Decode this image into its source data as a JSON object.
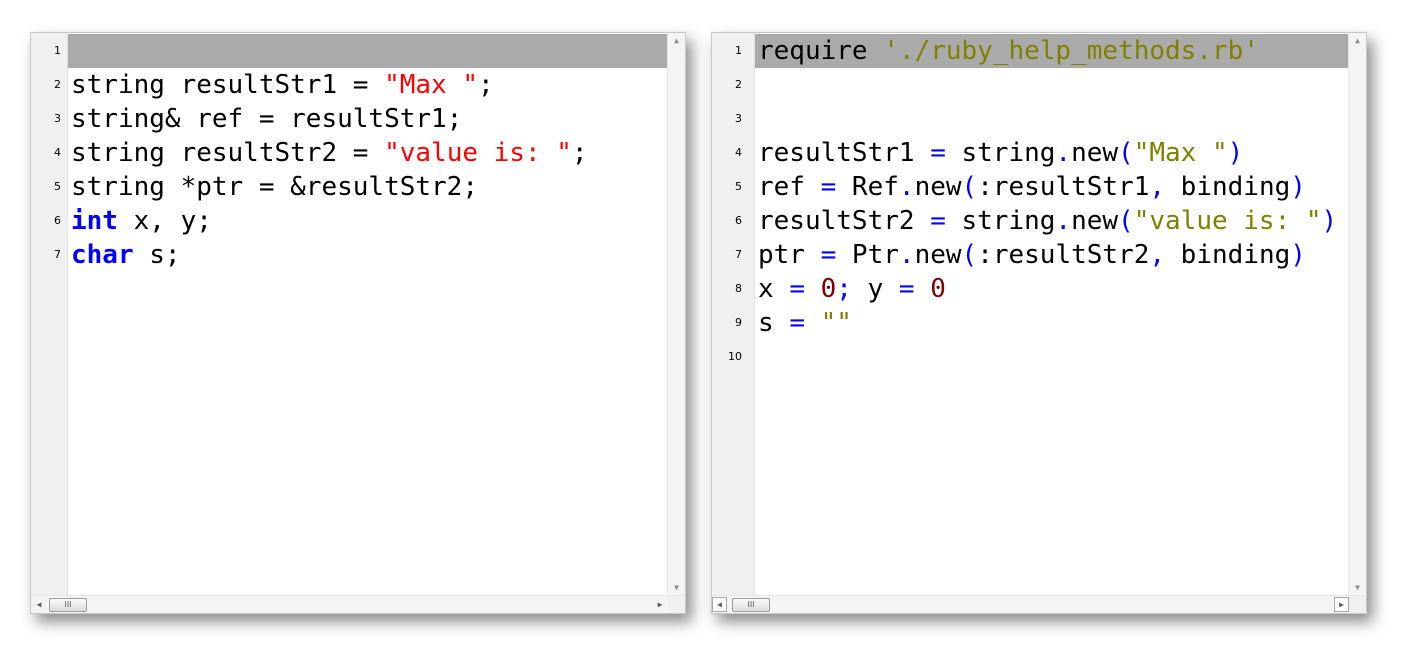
{
  "left_editor": {
    "lines": [
      {
        "num": "1",
        "tokens": []
      },
      {
        "num": "2",
        "tokens": [
          {
            "t": "string resultStr1 = ",
            "c": ""
          },
          {
            "t": "\"Max \"",
            "c": "str"
          },
          {
            "t": ";",
            "c": ""
          }
        ]
      },
      {
        "num": "3",
        "tokens": [
          {
            "t": "string& ref = resultStr1;",
            "c": ""
          }
        ]
      },
      {
        "num": "4",
        "tokens": [
          {
            "t": "string resultStr2 = ",
            "c": ""
          },
          {
            "t": "\"value is: \"",
            "c": "str"
          },
          {
            "t": ";",
            "c": ""
          }
        ]
      },
      {
        "num": "5",
        "tokens": [
          {
            "t": "string *ptr = &resultStr2;",
            "c": ""
          }
        ]
      },
      {
        "num": "6",
        "tokens": [
          {
            "t": "int",
            "c": "kw"
          },
          {
            "t": " x, y;",
            "c": ""
          }
        ]
      },
      {
        "num": "7",
        "tokens": [
          {
            "t": "char",
            "c": "kw"
          },
          {
            "t": " s;",
            "c": ""
          }
        ]
      }
    ]
  },
  "right_editor": {
    "lines": [
      {
        "num": "1",
        "tokens": [
          {
            "t": "require ",
            "c": ""
          },
          {
            "t": "'./ruby_help_methods.rb'",
            "c": "rstr"
          }
        ]
      },
      {
        "num": "2",
        "tokens": []
      },
      {
        "num": "3",
        "tokens": []
      },
      {
        "num": "4",
        "tokens": [
          {
            "t": "resultStr1 ",
            "c": ""
          },
          {
            "t": "=",
            "c": "op"
          },
          {
            "t": " string",
            "c": ""
          },
          {
            "t": ".",
            "c": "op"
          },
          {
            "t": "new",
            "c": ""
          },
          {
            "t": "(",
            "c": "op"
          },
          {
            "t": "\"Max \"",
            "c": "rstr"
          },
          {
            "t": ")",
            "c": "op"
          }
        ]
      },
      {
        "num": "5",
        "tokens": [
          {
            "t": "ref ",
            "c": ""
          },
          {
            "t": "=",
            "c": "op"
          },
          {
            "t": " Ref",
            "c": ""
          },
          {
            "t": ".",
            "c": "op"
          },
          {
            "t": "new",
            "c": ""
          },
          {
            "t": "(",
            "c": "op"
          },
          {
            "t": ":resultStr1",
            "c": ""
          },
          {
            "t": ",",
            "c": "op"
          },
          {
            "t": " binding",
            "c": ""
          },
          {
            "t": ")",
            "c": "op"
          }
        ]
      },
      {
        "num": "6",
        "tokens": [
          {
            "t": "resultStr2 ",
            "c": ""
          },
          {
            "t": "=",
            "c": "op"
          },
          {
            "t": " string",
            "c": ""
          },
          {
            "t": ".",
            "c": "op"
          },
          {
            "t": "new",
            "c": ""
          },
          {
            "t": "(",
            "c": "op"
          },
          {
            "t": "\"value is: \"",
            "c": "rstr"
          },
          {
            "t": ")",
            "c": "op"
          }
        ]
      },
      {
        "num": "7",
        "tokens": [
          {
            "t": "ptr ",
            "c": ""
          },
          {
            "t": "=",
            "c": "op"
          },
          {
            "t": " Ptr",
            "c": ""
          },
          {
            "t": ".",
            "c": "op"
          },
          {
            "t": "new",
            "c": ""
          },
          {
            "t": "(",
            "c": "op"
          },
          {
            "t": ":resultStr2",
            "c": ""
          },
          {
            "t": ",",
            "c": "op"
          },
          {
            "t": " binding",
            "c": ""
          },
          {
            "t": ")",
            "c": "op"
          }
        ]
      },
      {
        "num": "8",
        "tokens": [
          {
            "t": "x ",
            "c": ""
          },
          {
            "t": "=",
            "c": "op"
          },
          {
            "t": " ",
            "c": ""
          },
          {
            "t": "0",
            "c": "num"
          },
          {
            "t": ";",
            "c": "op"
          },
          {
            "t": " y ",
            "c": ""
          },
          {
            "t": "=",
            "c": "op"
          },
          {
            "t": " ",
            "c": ""
          },
          {
            "t": "0",
            "c": "num"
          }
        ]
      },
      {
        "num": "9",
        "tokens": [
          {
            "t": "s ",
            "c": ""
          },
          {
            "t": "=",
            "c": "op"
          },
          {
            "t": " ",
            "c": ""
          },
          {
            "t": "\"\"",
            "c": "rstr"
          }
        ]
      },
      {
        "num": "10",
        "tokens": []
      }
    ]
  },
  "scrollbar_thumb_glyph": "III",
  "colors": {
    "keyword": "#0000ff",
    "cpp_string": "#ff0000",
    "ruby_string": "#808000",
    "operator": "#0000ff",
    "number": "#800000",
    "current_line": "#aaaaaa"
  }
}
